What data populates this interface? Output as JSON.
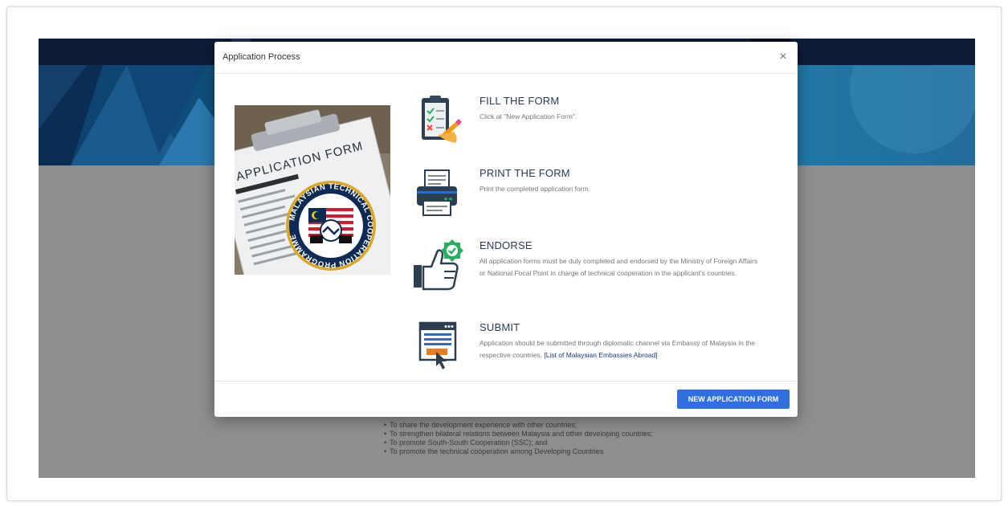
{
  "background_page": {
    "objectives": [
      "To share the development experience with other countries;",
      "To strengthen bilateral relations between Malaysia and other developing countries;",
      "To promote South-South Cooperation (SSC); and",
      "To promote the technical cooperation among Developing Countries"
    ]
  },
  "modal": {
    "title": "Application Process",
    "close_label": "×",
    "image": {
      "header_text": "APPLICATION FORM",
      "seal_text": "MALAYSIAN TECHNICAL COOPERATION PROGRAMME"
    },
    "steps": [
      {
        "title": "FILL THE FORM",
        "description": "Click at \"New Application Form\".",
        "icon": "clipboard-checklist-icon"
      },
      {
        "title": "PRINT THE FORM",
        "description": "Print the completed application form.",
        "icon": "printer-icon"
      },
      {
        "title": "ENDORSE",
        "description": "All application forms must be duly completed and endorsed by the Ministry of Foreign Affairs or National Focal Point in charge of technical cooperation in the applicant's countries.",
        "icon": "thumbs-up-badge-icon"
      },
      {
        "title": "SUBMIT",
        "description": "Application should be submitted through diplomatic channel via Embassy of Malaysia in the respective countries.",
        "link": "[List of Malaysian Embassies Abroad]",
        "icon": "browser-click-icon"
      }
    ],
    "footer": {
      "button_label": "NEW APPLICATION FORM"
    }
  },
  "colors": {
    "accent": "#2f6fe0",
    "hero": "#14628f",
    "navbar": "#0d1c36",
    "overlay": "#8e8e8e"
  }
}
